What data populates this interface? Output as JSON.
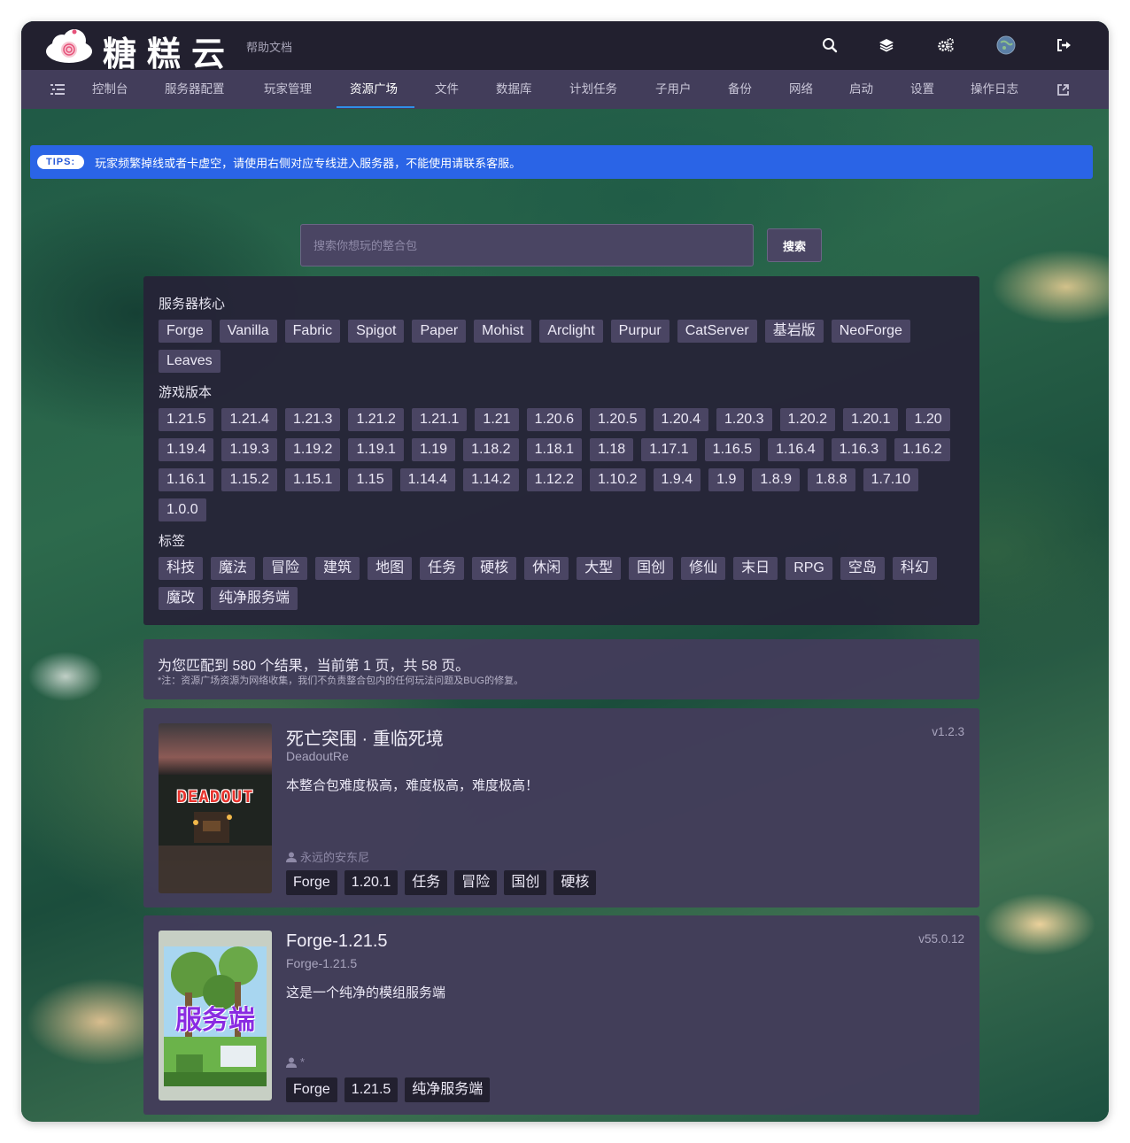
{
  "header": {
    "logo_text": "糖糕云",
    "help_link": "帮助文档",
    "icons": [
      "search-icon",
      "layers-icon",
      "settings-cogs-icon",
      "user-avatar",
      "logout-icon"
    ]
  },
  "nav": {
    "items": [
      {
        "label": "控制台"
      },
      {
        "label": "服务器配置"
      },
      {
        "label": "玩家管理"
      },
      {
        "label": "资源广场"
      },
      {
        "label": "文件"
      },
      {
        "label": "数据库"
      },
      {
        "label": "计划任务"
      },
      {
        "label": "子用户"
      },
      {
        "label": "备份"
      },
      {
        "label": "网络"
      },
      {
        "label": "启动"
      },
      {
        "label": "设置"
      },
      {
        "label": "操作日志"
      }
    ],
    "active_index": 3
  },
  "tips": {
    "badge": "TIPS:",
    "text": "玩家频繁掉线或者卡虚空，请使用右侧对应专线进入服务器，不能使用请联系客服。"
  },
  "search": {
    "placeholder": "搜索你想玩的整合包",
    "value": "",
    "button_label": "搜索"
  },
  "filters": {
    "core_title": "服务器核心",
    "cores": [
      "Forge",
      "Vanilla",
      "Fabric",
      "Spigot",
      "Paper",
      "Mohist",
      "Arclight",
      "Purpur",
      "CatServer",
      "基岩版",
      "NeoForge",
      "Leaves"
    ],
    "version_title": "游戏版本",
    "versions": [
      "1.21.5",
      "1.21.4",
      "1.21.3",
      "1.21.2",
      "1.21.1",
      "1.21",
      "1.20.6",
      "1.20.5",
      "1.20.4",
      "1.20.3",
      "1.20.2",
      "1.20.1",
      "1.20",
      "1.19.4",
      "1.19.3",
      "1.19.2",
      "1.19.1",
      "1.19",
      "1.18.2",
      "1.18.1",
      "1.18",
      "1.17.1",
      "1.16.5",
      "1.16.4",
      "1.16.3",
      "1.16.2",
      "1.16.1",
      "1.15.2",
      "1.15.1",
      "1.15",
      "1.14.4",
      "1.14.2",
      "1.12.2",
      "1.10.2",
      "1.9.4",
      "1.9",
      "1.8.9",
      "1.8.8",
      "1.7.10",
      "1.0.0"
    ],
    "tag_title": "标签",
    "tags": [
      "科技",
      "魔法",
      "冒险",
      "建筑",
      "地图",
      "任务",
      "硬核",
      "休闲",
      "大型",
      "国创",
      "修仙",
      "末日",
      "RPG",
      "空岛",
      "科幻",
      "魔改",
      "纯净服务端"
    ]
  },
  "results": {
    "summary": "为您匹配到 580 个结果，当前第 1 页，共 58 页。",
    "note": "*注：资源广场资源为网络收集，我们不负责整合包内的任何玩法问题及BUG的修复。"
  },
  "modpacks": [
    {
      "title": "死亡突围 · 重临死境",
      "subtitle": "DeadoutRe",
      "description": "本整合包难度极高，难度极高，难度极高！",
      "version": "v1.2.3",
      "author": "永远的安东尼",
      "thumb_text": "DEADOUT",
      "tags": [
        "Forge",
        "1.20.1",
        "任务",
        "冒险",
        "国创",
        "硬核"
      ]
    },
    {
      "title": "Forge-1.21.5",
      "subtitle": "Forge-1.21.5",
      "description": "这是一个纯净的模组服务端",
      "version": "v55.0.12",
      "author": "*",
      "thumb_text": "服务端",
      "tags": [
        "Forge",
        "1.21.5",
        "纯净服务端"
      ]
    }
  ]
}
